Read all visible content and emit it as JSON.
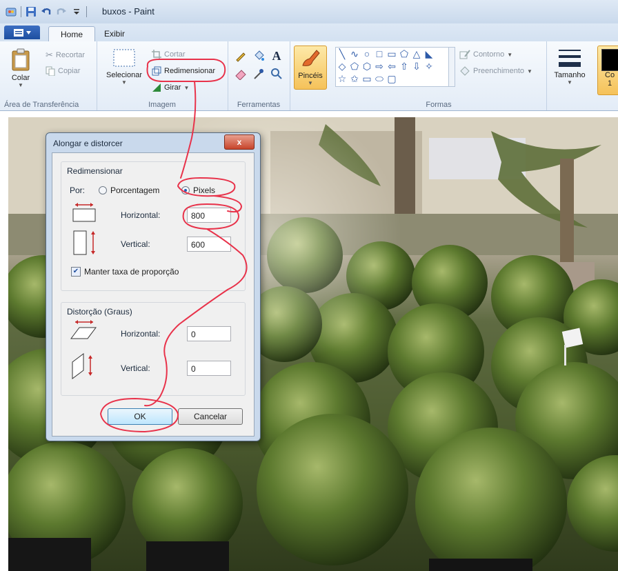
{
  "window": {
    "title": "buxos - Paint"
  },
  "tabs": [
    {
      "label": "Home"
    },
    {
      "label": "Exibir"
    }
  ],
  "ribbon": {
    "clipboard": {
      "paste": "Colar",
      "cut": "Recortar",
      "copy": "Copiar",
      "group_label": "Área de Transferência"
    },
    "image": {
      "select": "Selecionar",
      "crop": "Cortar",
      "resize": "Redimensionar",
      "rotate": "Girar",
      "group_label": "Imagem"
    },
    "tools": {
      "group_label": "Ferramentas"
    },
    "brushes": {
      "label": "Pincéis"
    },
    "shapes": {
      "outline": "Contorno",
      "fill": "Preenchimento",
      "group_label": "Formas",
      "glyphs": [
        "╲",
        "∿",
        "○",
        "□",
        "▭",
        "⬠",
        "△",
        "◣",
        "◇",
        "⬠",
        "⬡",
        "⬭",
        "⇨",
        "⇦",
        "⇧",
        "⇩",
        "✧",
        "☆",
        "✩",
        "▭",
        "⬭",
        "▢"
      ]
    },
    "size": {
      "label": "Tamanho"
    },
    "color1": {
      "label": "Co",
      "index": "1"
    }
  },
  "dialog": {
    "title": "Alongar e distorcer",
    "close_label": "x",
    "resize": {
      "legend": "Redimensionar",
      "by_label": "Por:",
      "percent_label": "Porcentagem",
      "pixels_label": "Pixels",
      "selected_unit": "Pixels",
      "horizontal_label": "Horizontal:",
      "horizontal_value": "800",
      "vertical_label": "Vertical:",
      "vertical_value": "600",
      "keep_ratio_label": "Manter taxa de proporção",
      "keep_ratio_checked": true
    },
    "skew": {
      "legend": "Distorção (Graus)",
      "horizontal_label": "Horizontal:",
      "horizontal_value": "0",
      "vertical_label": "Vertical:",
      "vertical_value": "0"
    },
    "ok_label": "OK",
    "cancel_label": "Cancelar"
  },
  "colors": {
    "annotation": "#e8324a",
    "ribbon_accent": "#1d4ea0"
  }
}
